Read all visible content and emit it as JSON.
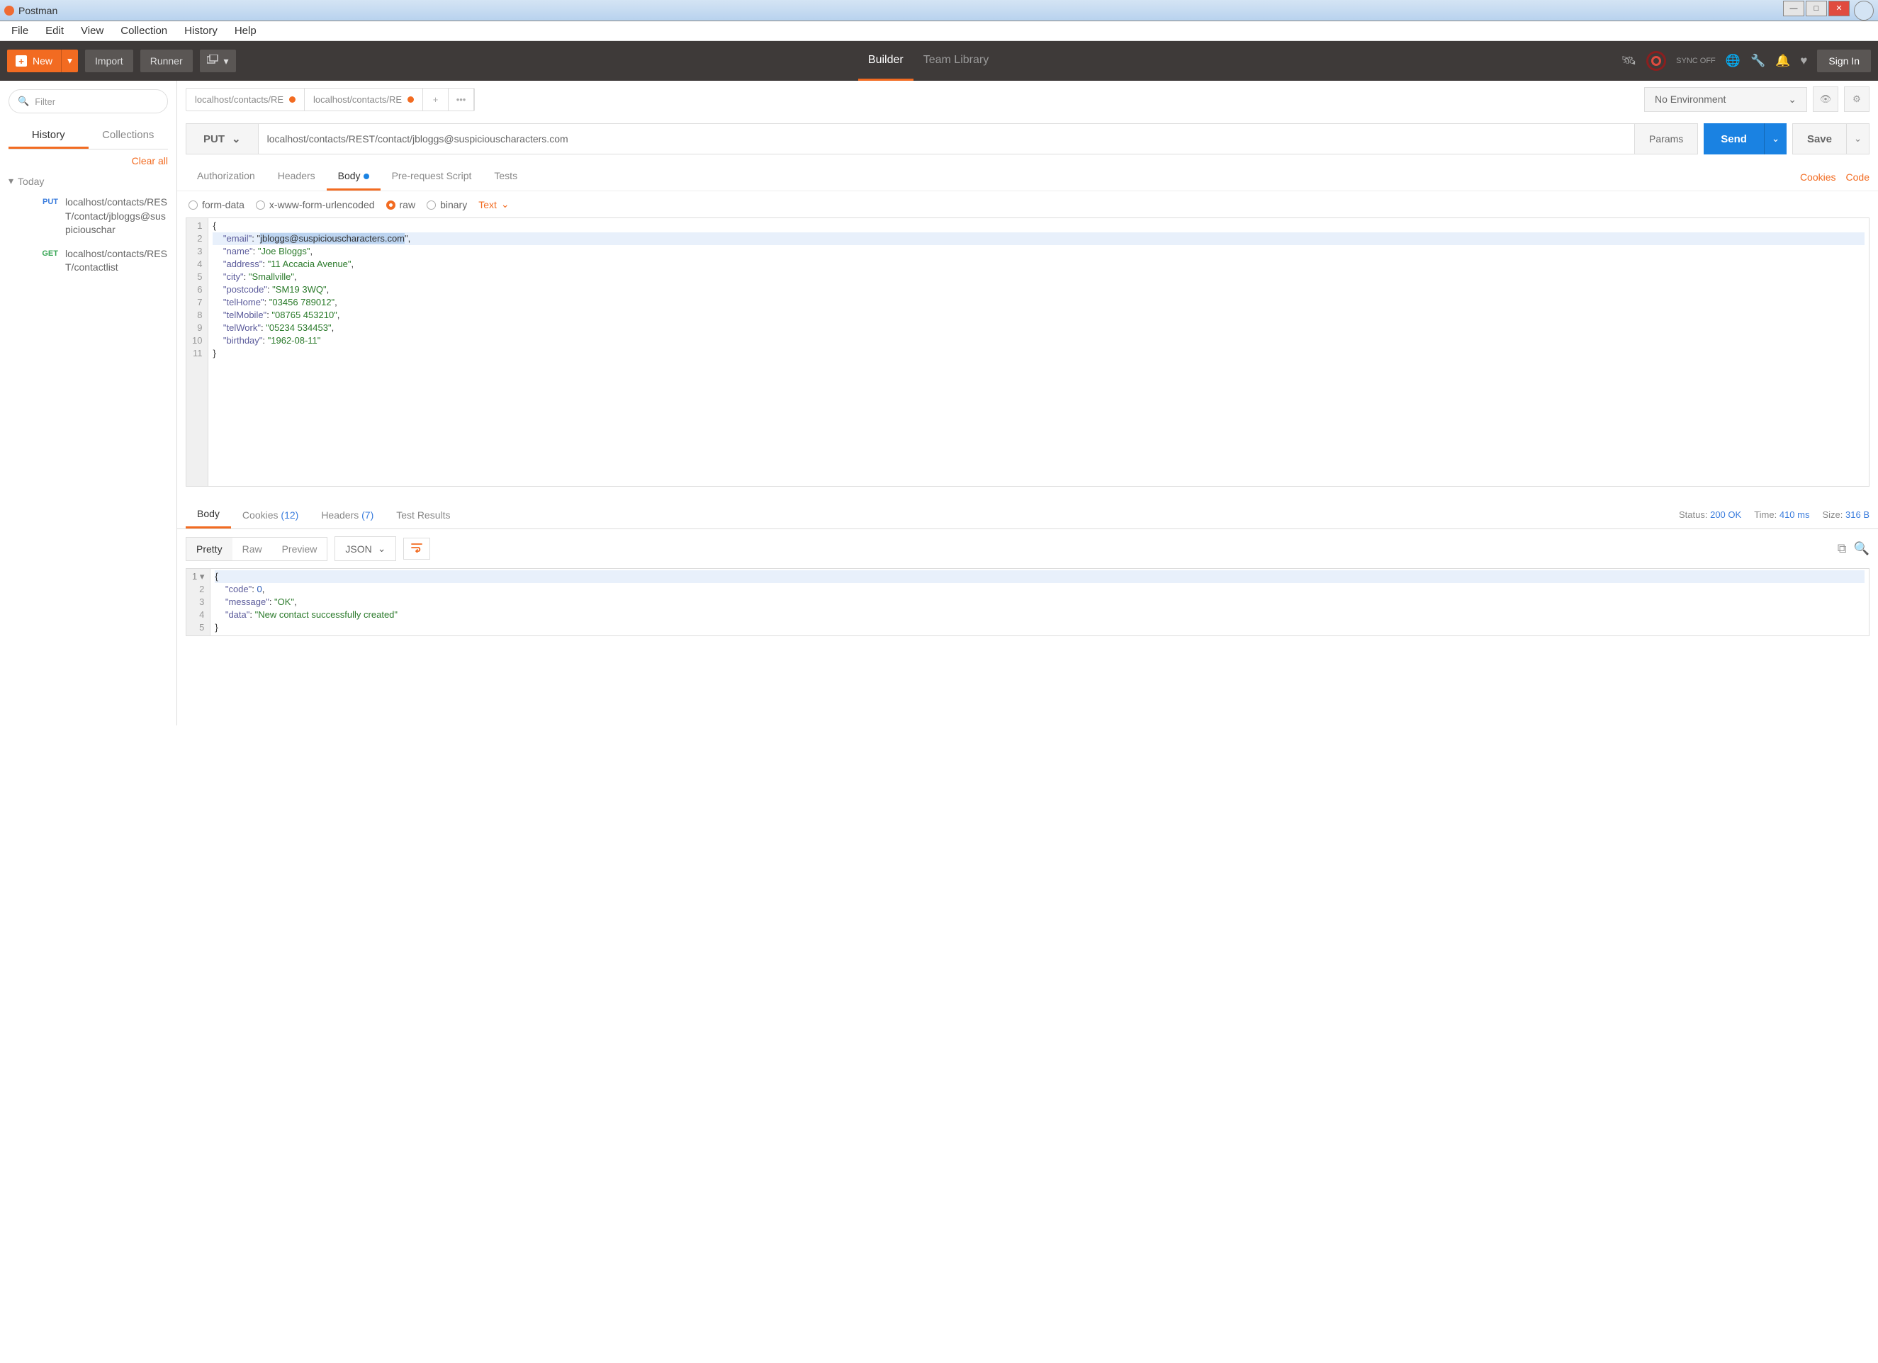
{
  "window": {
    "title": "Postman"
  },
  "menubar": [
    "File",
    "Edit",
    "View",
    "Collection",
    "History",
    "Help"
  ],
  "toolbar": {
    "new": "New",
    "import": "Import",
    "runner": "Runner",
    "tabs": [
      "Builder",
      "Team Library"
    ],
    "sync_off": "SYNC OFF",
    "signin": "Sign In"
  },
  "sidebar": {
    "filter_placeholder": "Filter",
    "tabs": [
      "History",
      "Collections"
    ],
    "clear_all": "Clear all",
    "group": "Today",
    "items": [
      {
        "method": "PUT",
        "url": "localhost/contacts/REST/contact/jbloggs@suspiciouschar"
      },
      {
        "method": "GET",
        "url": "localhost/contacts/REST/contactlist"
      }
    ]
  },
  "env": {
    "selected": "No Environment"
  },
  "request_tabs": [
    {
      "label": "localhost/contacts/RE",
      "dirty": true
    },
    {
      "label": "localhost/contacts/RE",
      "dirty": true
    }
  ],
  "request": {
    "method": "PUT",
    "url": "localhost/contacts/REST/contact/jbloggs@suspiciouscharacters.com",
    "params": "Params",
    "send": "Send",
    "save": "Save"
  },
  "sub_tabs": [
    "Authorization",
    "Headers",
    "Body",
    "Pre-request Script",
    "Tests"
  ],
  "cookies_link": "Cookies",
  "code_link": "Code",
  "body_opts": {
    "formdata": "form-data",
    "xwww": "x-www-form-urlencoded",
    "raw": "raw",
    "binary": "binary",
    "text": "Text"
  },
  "body_lines": [
    "{",
    "    \"email\": \"jbloggs@suspiciouscharacters.com\",",
    "    \"name\": \"Joe Bloggs\",",
    "    \"address\": \"11 Accacia Avenue\",",
    "    \"city\": \"Smallville\",",
    "    \"postcode\": \"SM19 3WQ\",",
    "    \"telHome\": \"03456 789012\",",
    "    \"telMobile\": \"08765 453210\",",
    "    \"telWork\": \"05234 534453\",",
    "    \"birthday\": \"1962-08-11\"",
    "}"
  ],
  "response": {
    "tabs": [
      "Body",
      "Cookies",
      "Headers",
      "Test Results"
    ],
    "cookies_count": "(12)",
    "headers_count": "(7)",
    "status_label": "Status:",
    "status": "200 OK",
    "time_label": "Time:",
    "time": "410 ms",
    "size_label": "Size:",
    "size": "316 B",
    "view_modes": [
      "Pretty",
      "Raw",
      "Preview"
    ],
    "format": "JSON"
  },
  "response_lines": [
    "{",
    "    \"code\": 0,",
    "    \"message\": \"OK\",",
    "    \"data\": \"New contact successfully created\"",
    "}"
  ]
}
